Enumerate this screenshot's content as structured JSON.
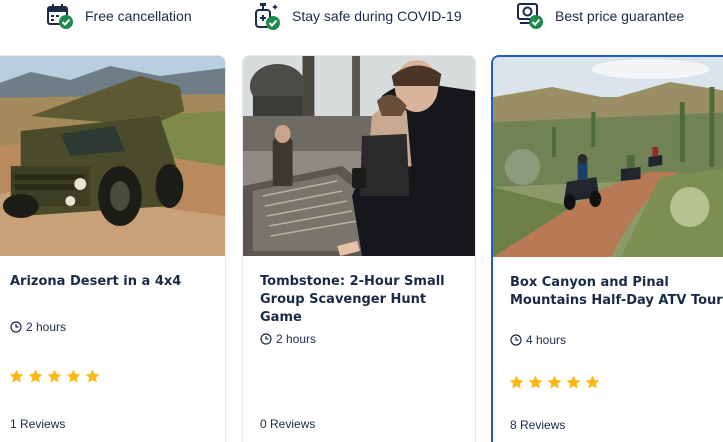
{
  "features": [
    {
      "icon": "calendar-check-icon",
      "label": "Free cancellation"
    },
    {
      "icon": "sanitizer-check-icon",
      "label": "Stay safe during COVID-19"
    },
    {
      "icon": "price-tag-check-icon",
      "label": "Best price guarantee"
    }
  ],
  "cards": [
    {
      "title": "Arizona Desert in a 4x4",
      "duration": "2 hours",
      "rating_stars": 5,
      "reviews": "1 Reviews"
    },
    {
      "title": "Tombstone: 2-Hour Small Group Scavenger Hunt Game",
      "duration": "2 hours",
      "rating_stars": 0,
      "reviews": "0 Reviews"
    },
    {
      "title": "Box Canyon and Pinal Mountains Half-Day ATV Tour",
      "duration": "4 hours",
      "rating_stars": 5,
      "reviews": "8 Reviews"
    }
  ],
  "colors": {
    "star": "#fdb813",
    "check": "#1b8a4c",
    "selected_border": "#1f5fc4",
    "text": "#1a2b49"
  }
}
